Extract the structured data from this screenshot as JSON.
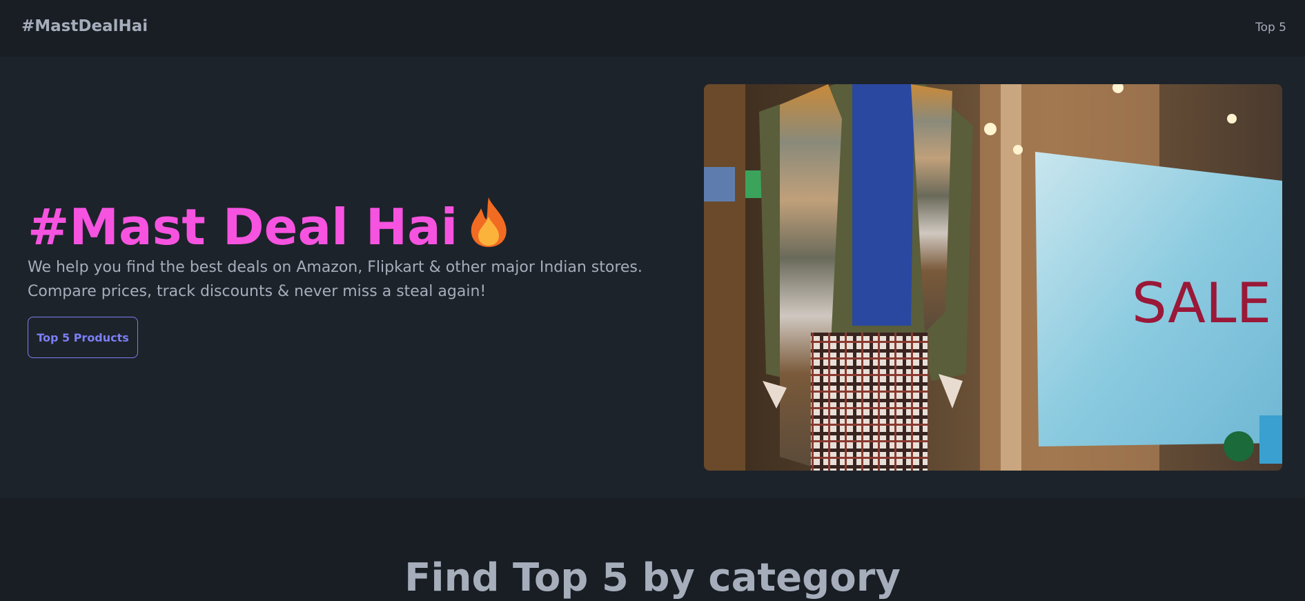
{
  "navbar": {
    "brand": "#MastDealHai",
    "link_label": "Top 5"
  },
  "hero": {
    "title": "#Mast Deal Hai",
    "title_icon": "fire-icon",
    "description": "We help you find the best deals on Amazon, Flipkart & other major Indian stores. Compare prices, track discounts & never miss a steal again!",
    "button_label": "Top 5 Products",
    "image_sign_text": "SALE"
  },
  "section": {
    "title": "Find Top 5 by category"
  },
  "colors": {
    "background": "#1d232a",
    "navbar": "#191d24",
    "accent_pink": "#f653e0",
    "accent_indigo": "#7b7ff5",
    "text_muted": "#a6adbb"
  }
}
